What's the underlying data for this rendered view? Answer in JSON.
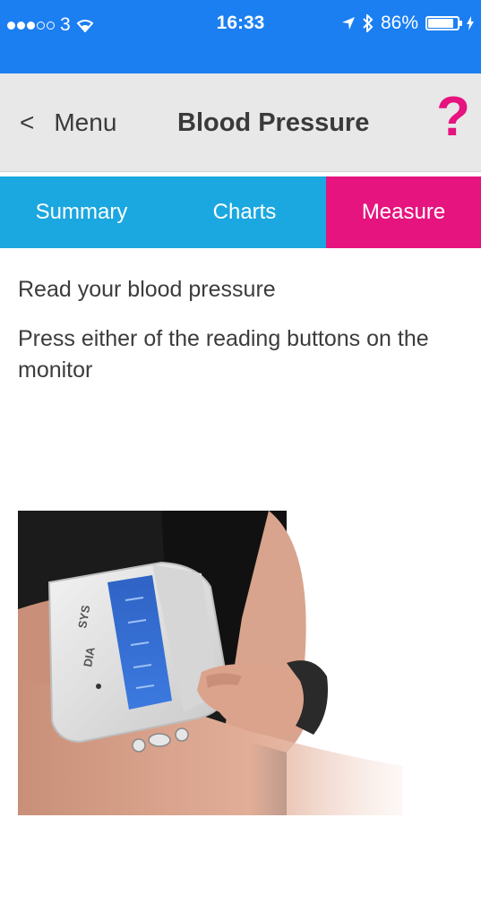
{
  "status_bar": {
    "carrier": "3",
    "time": "16:33",
    "battery_percent": "86%",
    "battery_level": 0.86,
    "background_color": "#1b7ff2"
  },
  "nav": {
    "back_label": "Menu",
    "back_chevron": "<",
    "title": "Blood Pressure",
    "help_label": "?",
    "help_color": "#e5147e"
  },
  "tabs": [
    {
      "label": "Summary",
      "active": false
    },
    {
      "label": "Charts",
      "active": false
    },
    {
      "label": "Measure",
      "active": true
    }
  ],
  "content": {
    "heading": "Read your blood pressure",
    "instruction": "Press either of the reading buttons on the monitor"
  },
  "monitor": {
    "sys_label": "SYS",
    "dia_label": "DIA"
  },
  "colors": {
    "tab_blue": "#1ba7e0",
    "tab_active": "#e5147e"
  }
}
